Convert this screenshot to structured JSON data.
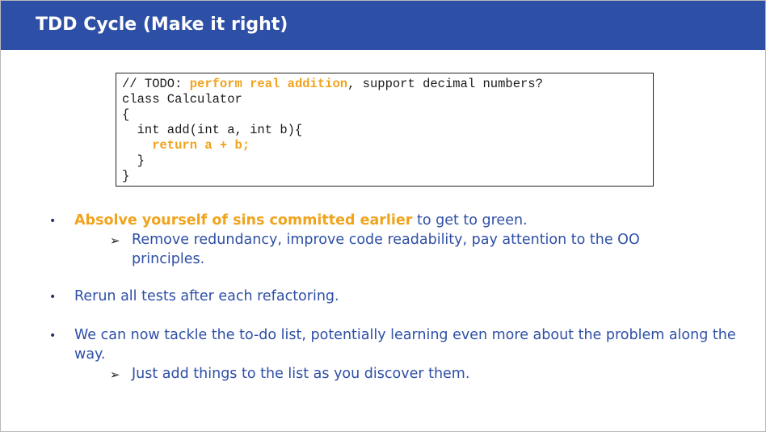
{
  "header": {
    "title": "TDD Cycle (Make it right)"
  },
  "code": {
    "line1_prefix": "// TODO: ",
    "line1_highlight": "perform real addition",
    "line1_suffix": ", support decimal numbers?",
    "line2": "class Calculator",
    "line3": "{",
    "line4": "  int add(int a, int b){",
    "line5_highlight": "    return a + b;",
    "line6": "  }",
    "line7": "}"
  },
  "bullets": {
    "b1_highlight": "Absolve yourself of sins committed earlier",
    "b1_rest": " to get to green.",
    "b1_sub1": "Remove redundancy, improve code readability, pay attention to the OO principles.",
    "b2": "Rerun all tests after each refactoring.",
    "b3": "We can now tackle the to-do list, potentially learning even more about the problem along the way.",
    "b3_sub1": "Just add things to the list as you discover them.",
    "dot_char": "•",
    "arrow_char": "➢"
  },
  "colors": {
    "header_bg": "#2e4fa6",
    "accent_orange": "#f0a31c",
    "text_blue": "#2e4fa6"
  }
}
